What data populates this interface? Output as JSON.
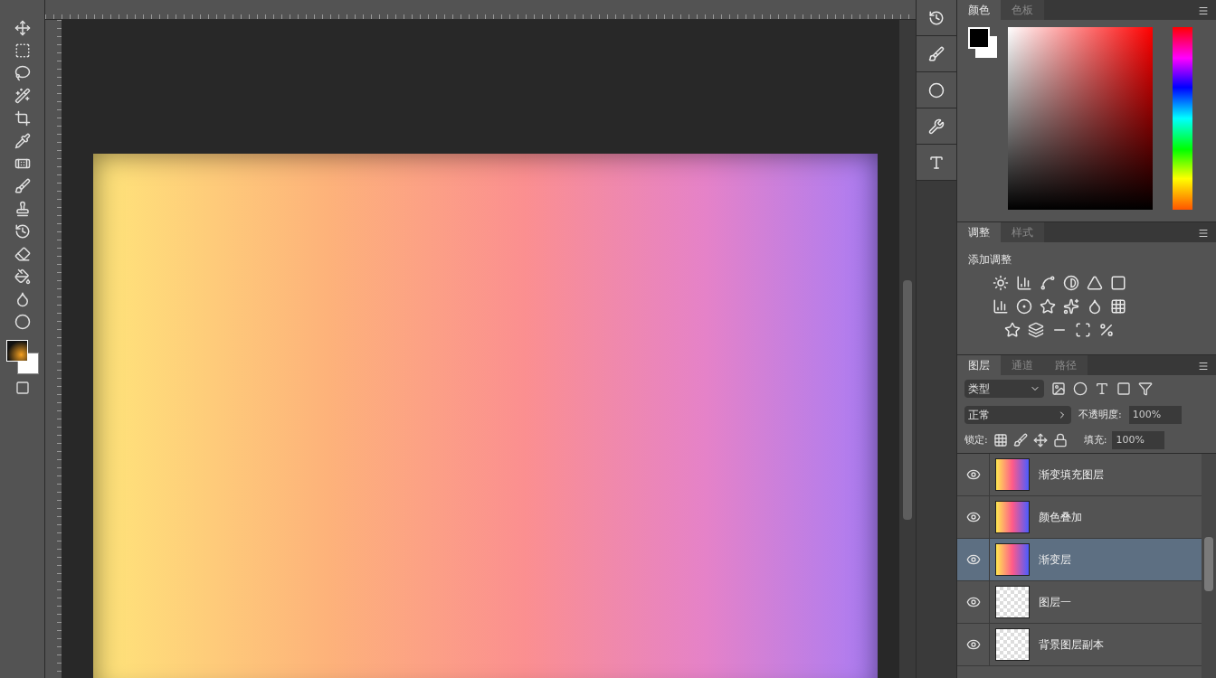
{
  "toolbar": {
    "tools": [
      {
        "kind": "move"
      },
      {
        "kind": "marquee"
      },
      {
        "kind": "lasso"
      },
      {
        "kind": "wand"
      },
      {
        "kind": "crop"
      },
      {
        "kind": "eyedropper"
      },
      {
        "kind": "heal"
      },
      {
        "kind": "brush"
      },
      {
        "kind": "stamp"
      },
      {
        "kind": "history"
      },
      {
        "kind": "eraser"
      },
      {
        "kind": "bucket"
      },
      {
        "kind": "blur"
      },
      {
        "kind": "dodge"
      }
    ]
  },
  "side_icons": [
    {
      "kind": "history"
    },
    {
      "kind": "brush"
    },
    {
      "kind": "circle"
    },
    {
      "kind": "tools"
    },
    {
      "kind": "type"
    }
  ],
  "color_panel": {
    "tabs": [
      {
        "label": "颜色",
        "selected": true
      },
      {
        "label": "色板",
        "selected": false
      }
    ]
  },
  "adjustments_panel": {
    "tabs": [
      {
        "label": "调整",
        "selected": true
      },
      {
        "label": "样式",
        "selected": false
      }
    ],
    "title": "添加调整",
    "rows": [
      {
        "icons": [
          {
            "kind": "sun"
          },
          {
            "kind": "bars"
          },
          {
            "kind": "curve"
          },
          {
            "kind": "contrast"
          },
          {
            "kind": "triangle"
          },
          {
            "kind": "square"
          }
        ]
      },
      {
        "icons": [
          {
            "kind": "chart"
          },
          {
            "kind": "half"
          },
          {
            "kind": "star"
          },
          {
            "kind": "star2"
          },
          {
            "kind": "drop"
          },
          {
            "kind": "grid"
          }
        ]
      },
      {
        "icons": [
          {
            "kind": "star"
          },
          {
            "kind": "layers"
          },
          {
            "kind": "minus"
          },
          {
            "kind": "scan"
          },
          {
            "kind": "percent"
          }
        ]
      }
    ]
  },
  "layers_panel": {
    "tabs": [
      {
        "label": "图层",
        "selected": true
      },
      {
        "label": "通道",
        "selected": false
      },
      {
        "label": "路径",
        "selected": false
      }
    ],
    "kind_filter": "类型",
    "blend_mode": "正常",
    "opacity_label": "不透明度:",
    "opacity_value": "100%",
    "lock_label": "锁定:",
    "fill_label": "填充:",
    "fill_value": "100%",
    "layers": [
      {
        "name": "渐变填充图层",
        "thumbnail": {
          "kind": "gradient"
        },
        "visible": true,
        "selected": false
      },
      {
        "name": "颜色叠加",
        "thumbnail": {
          "kind": "gradient"
        },
        "visible": true,
        "selected": false
      },
      {
        "name": "渐变层",
        "thumbnail": {
          "kind": "gradient"
        },
        "visible": true,
        "selected": true
      },
      {
        "name": "图层一",
        "thumbnail": {
          "kind": "transparent"
        },
        "visible": true,
        "selected": false
      },
      {
        "name": "背景图层副本",
        "thumbnail": {
          "kind": "transparent"
        },
        "visible": true,
        "selected": false
      }
    ]
  }
}
